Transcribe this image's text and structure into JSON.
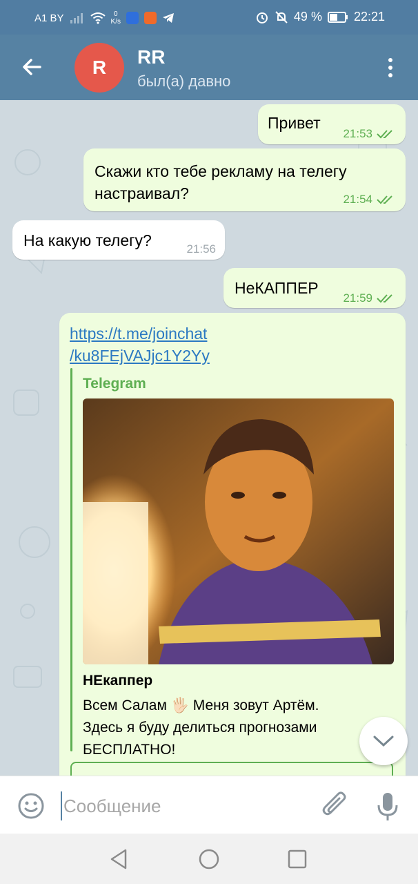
{
  "status_bar": {
    "carrier": "A1 BY",
    "speed_value": "0",
    "speed_unit": "K/s",
    "battery": "49 %",
    "time": "22:21"
  },
  "header": {
    "avatar_letter": "R",
    "avatar_color": "#e5584b",
    "name": "RR",
    "status": "был(а) давно"
  },
  "messages": [
    {
      "direction": "out",
      "text": "Привет",
      "time": "21:53",
      "read": true
    },
    {
      "direction": "out",
      "text_line1": "Скажи кто тебе рекламу на телегу",
      "text_line2": "настраивал?",
      "time": "21:54",
      "read": true
    },
    {
      "direction": "in",
      "text": "На какую телегу?",
      "time": "21:56"
    },
    {
      "direction": "out",
      "text": "НеКАППЕР",
      "time": "21:59",
      "read": true
    },
    {
      "direction": "out",
      "link_line1": "https://t.me/joinchat",
      "link_line2": "/ku8FEjVAJjc1Y2Yy",
      "preview": {
        "site": "Telegram",
        "title": "НЕкаппер",
        "desc_line1_a": "Всем Салам",
        "desc_line1_emoji": "🖐🏻",
        "desc_line1_b": "Меня зовут Артём.",
        "desc_line2": "Здесь я буду делиться прогнозами",
        "desc_line3": "БЕСПЛАТНО!"
      }
    }
  ],
  "input": {
    "placeholder": "Сообщение"
  },
  "colors": {
    "header_bg": "#5682a3",
    "outgoing_bubble": "#effdde",
    "incoming_bubble": "#ffffff",
    "accent_green": "#5eaf52",
    "link": "#2b79c2"
  },
  "icons": {
    "back": "arrow-left",
    "menu": "more-vertical",
    "scroll": "chevron-down",
    "emoji": "smile",
    "attach": "paperclip",
    "mic": "microphone",
    "nav_back": "triangle-back",
    "nav_home": "circle-home",
    "nav_recents": "square-recents"
  }
}
